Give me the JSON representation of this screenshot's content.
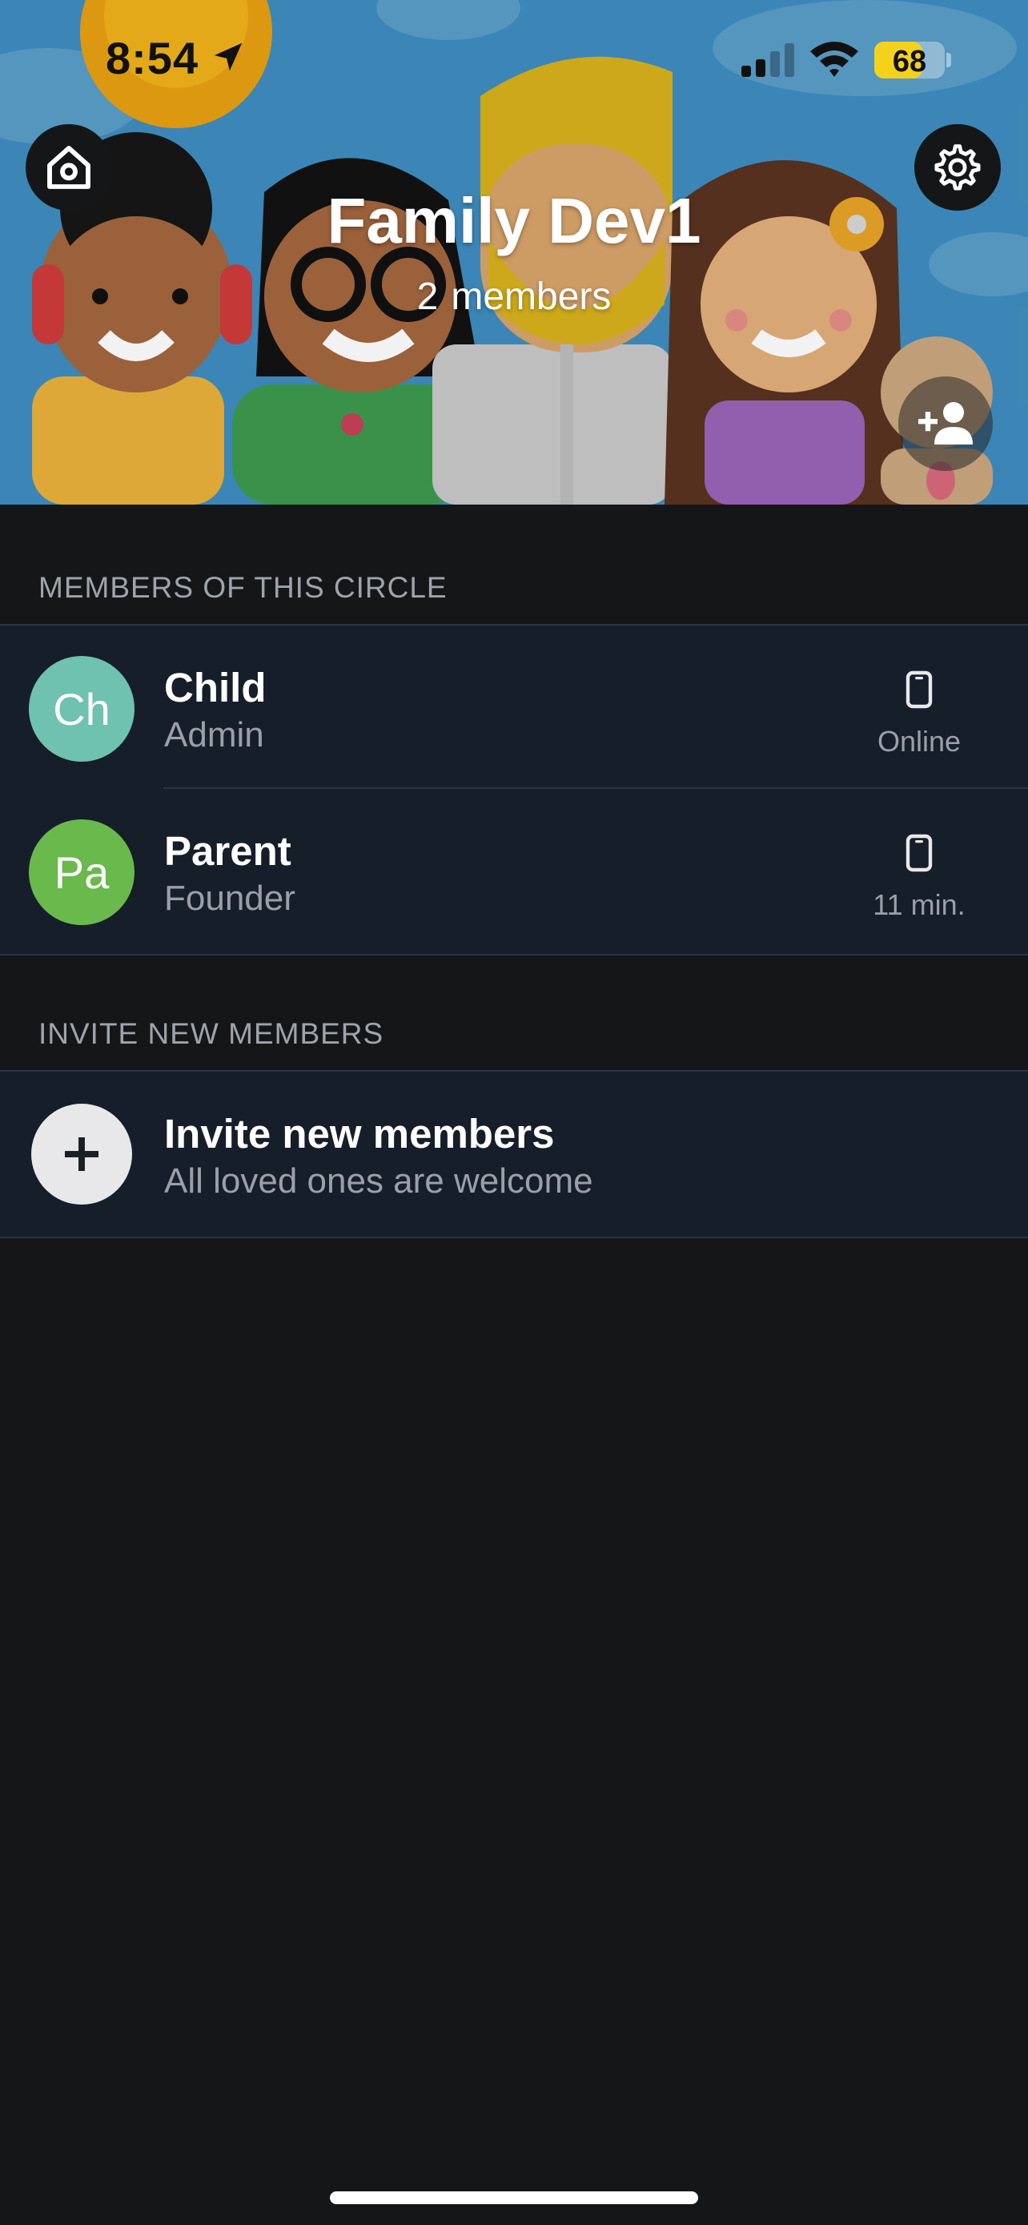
{
  "status_bar": {
    "time": "8:54",
    "battery": "68",
    "battery_level_percent": 68
  },
  "header": {
    "circle_name": "Family Dev1",
    "member_count": "2",
    "member_count_label": "members"
  },
  "members_section": {
    "title": "MEMBERS OF THIS CIRCLE",
    "members": [
      {
        "initials": "Ch",
        "name": "Child",
        "role": "Admin",
        "status": "Online",
        "avatar_color": "#6fc1b0"
      },
      {
        "initials": "Pa",
        "name": "Parent",
        "role": "Founder",
        "status": "11 min.",
        "avatar_color": "#6ab94d"
      }
    ]
  },
  "invite_section": {
    "title": "INVITE NEW MEMBERS",
    "item_title": "Invite new members",
    "item_subtitle": "All loved ones are welcome"
  },
  "icons": {
    "home": "home-icon",
    "settings": "gear-icon",
    "add_member": "add-person-icon",
    "device": "phone-icon",
    "plus": "plus-icon"
  },
  "colors": {
    "background": "#151618",
    "list_background": "#161e2a",
    "secondary_text": "#9aa0a8",
    "header_sky": "#3f8ec0",
    "battery": "#f4d21c"
  }
}
